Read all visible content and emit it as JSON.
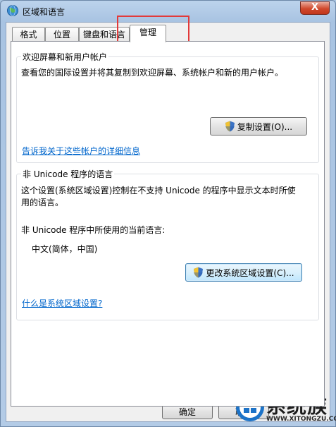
{
  "window": {
    "title": "区域和语言",
    "close_glyph": "X"
  },
  "tabs": [
    {
      "label": "格式"
    },
    {
      "label": "位置"
    },
    {
      "label": "键盘和语言"
    },
    {
      "label": "管理",
      "active": true
    }
  ],
  "welcome_group": {
    "title": "欢迎屏幕和新用户帐户",
    "description": "查看您的国际设置并将其复制到欢迎屏幕、系统帐户和新的用户帐户。",
    "copy_button": "复制设置(O)...",
    "link": "告诉我关于这些帐户的详细信息"
  },
  "unicode_group": {
    "title": "非 Unicode 程序的语言",
    "description_line1": "这个设置(系统区域设置)控制在不支持 Unicode 的程序中显示文本时所使",
    "description_line2": "用的语言。",
    "current_label": "非 Unicode 程序中所使用的当前语言:",
    "current_value": "中文(简体，中国)",
    "change_button": "更改系统区域设置(C)...",
    "link": "什么是系统区域设置?"
  },
  "footer": {
    "ok": "确定",
    "cancel": "取消"
  },
  "watermark": {
    "brand": "系统族",
    "url": "WWW.XITONGZU.COM"
  },
  "colors": {
    "highlight": "#e23a3a",
    "link": "#0066cc",
    "close": "#c2361c"
  }
}
